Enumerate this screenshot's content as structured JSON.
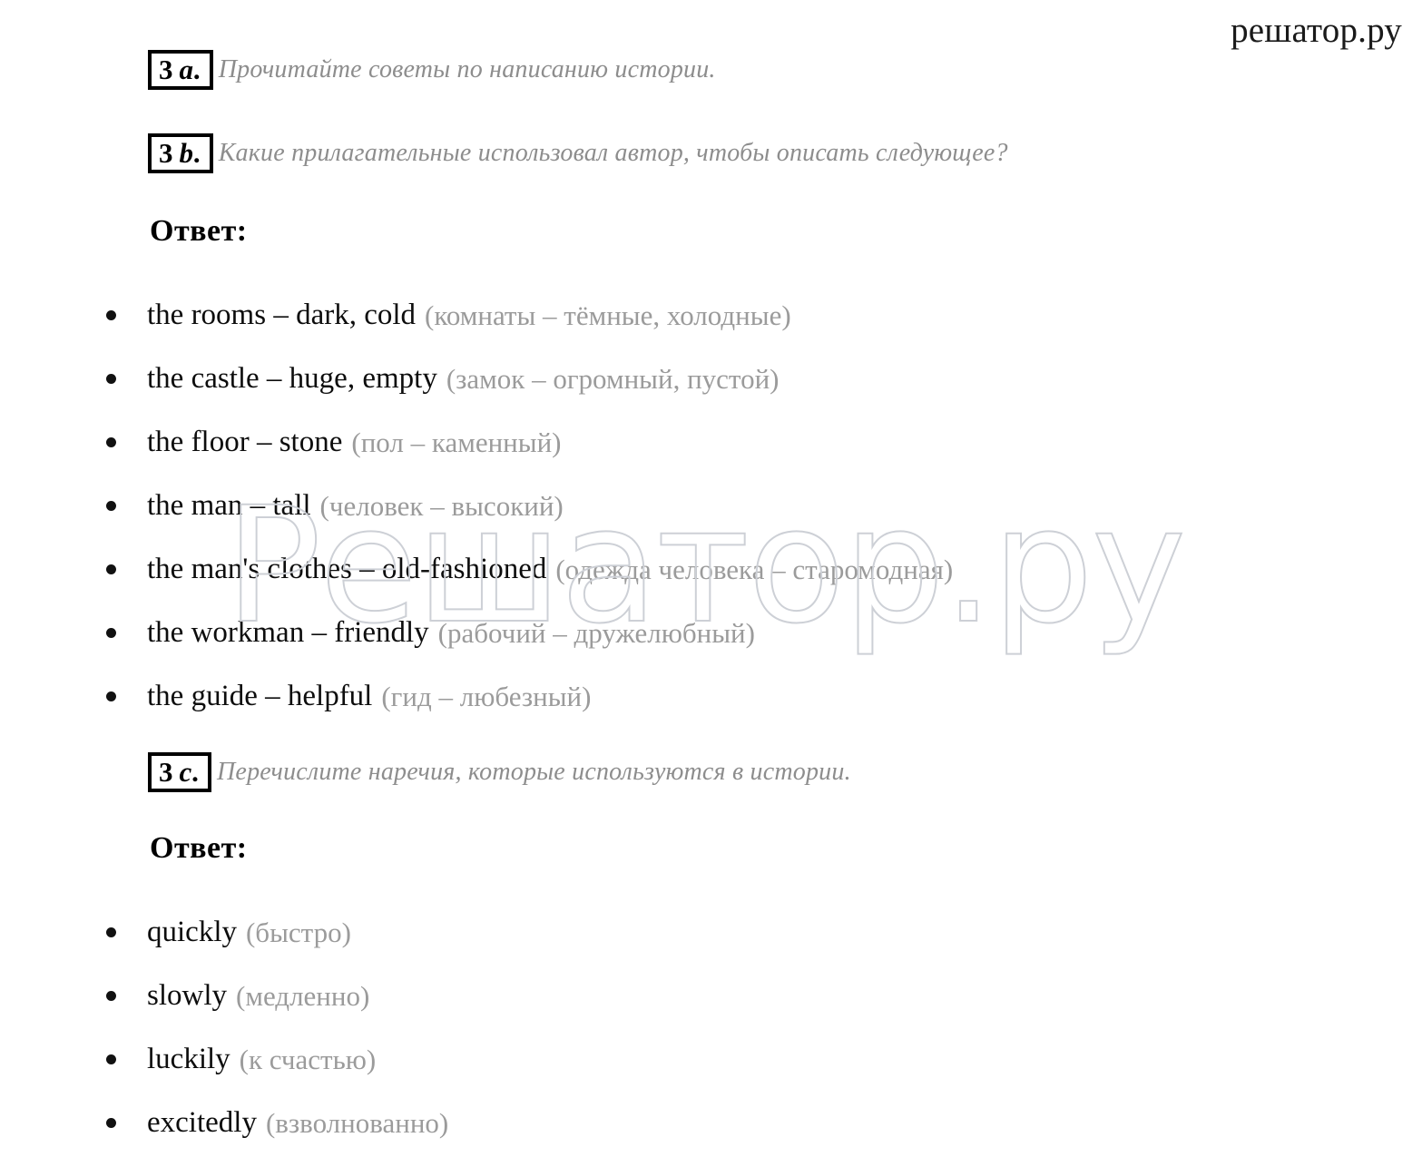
{
  "site": {
    "label": "решатор.ру",
    "watermark": "Решатор.ру"
  },
  "colors": {
    "text": "#0d0d0d",
    "translation_gray": "#9b9b9b",
    "task_gray": "#8d8d8d",
    "watermark_stroke": "#cdd0d6",
    "background": "#ffffff"
  },
  "tasks": [
    {
      "number": "3",
      "letter": "a.",
      "prompt": "Прочитайте советы по написанию истории."
    },
    {
      "number": "3",
      "letter": "b.",
      "prompt": "Какие прилагательные использовал автор, чтобы описать следующее?"
    },
    {
      "number": "3",
      "letter": "c.",
      "prompt": "Перечислите наречия, которые используются в истории."
    }
  ],
  "answer_heading": "Ответ:",
  "adjectives": [
    {
      "en": "the rooms – dark, cold",
      "ru": "(комнаты – тёмные, холодные)"
    },
    {
      "en": "the castle – huge, empty",
      "ru": "(замок – огромный, пустой)"
    },
    {
      "en": "the floor – stone",
      "ru": "(пол – каменный)"
    },
    {
      "en": "the man – tall",
      "ru": "(человек – высокий)"
    },
    {
      "en": "the man's clothes – old-fashioned",
      "ru": "(одежда человека – старомодная)"
    },
    {
      "en": "the workman – friendly",
      "ru": "(рабочий – дружелюбный)"
    },
    {
      "en": "the guide – helpful",
      "ru": "(гид – любезный)"
    }
  ],
  "adverbs": [
    {
      "en": "quickly",
      "ru": "(быстро)"
    },
    {
      "en": "slowly",
      "ru": "(медленно)"
    },
    {
      "en": "luckily",
      "ru": "(к счастью)"
    },
    {
      "en": "excitedly",
      "ru": "(взволнованно)"
    }
  ]
}
